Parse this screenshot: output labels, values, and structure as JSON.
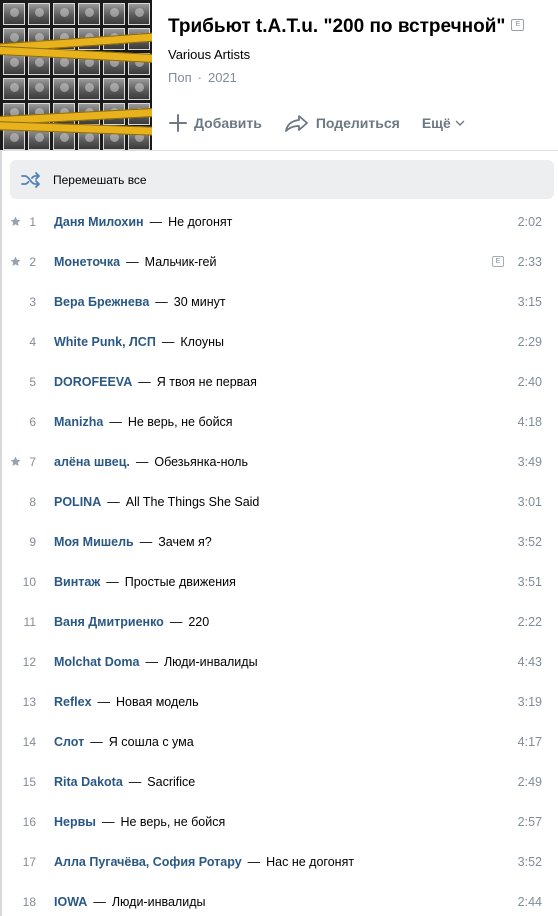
{
  "album": {
    "title": "Трибьют t.A.T.u. \"200 по встречной\"",
    "explicit_badge": "E",
    "artist": "Various Artists",
    "genre": "Поп",
    "separator": "·",
    "year": "2021"
  },
  "actions": {
    "add_label": "Добавить",
    "share_label": "Поделиться",
    "more_label": "Ещё"
  },
  "shuffle": {
    "label": "Перемешать все"
  },
  "colors": {
    "artist_link": "#2a5885",
    "muted": "#818c99",
    "accent_icon": "#5181b8",
    "shuffle_bg": "#edeef0"
  },
  "tracks": [
    {
      "num": "1",
      "starred": true,
      "artists": [
        "Даня Милохин"
      ],
      "title": "Не догонят",
      "duration": "2:02",
      "explicit": false
    },
    {
      "num": "2",
      "starred": true,
      "artists": [
        "Монеточка"
      ],
      "title": "Мальчик-гей",
      "duration": "2:33",
      "explicit": true
    },
    {
      "num": "3",
      "starred": false,
      "artists": [
        "Вера Брежнева"
      ],
      "title": "30 минут",
      "duration": "3:15",
      "explicit": false
    },
    {
      "num": "4",
      "starred": false,
      "artists": [
        "White Punk",
        "ЛСП"
      ],
      "title": "Клоуны",
      "duration": "2:29",
      "explicit": false
    },
    {
      "num": "5",
      "starred": false,
      "artists": [
        "DOROFEEVA"
      ],
      "title": "Я твоя не первая",
      "duration": "2:40",
      "explicit": false
    },
    {
      "num": "6",
      "starred": false,
      "artists": [
        "Manizha"
      ],
      "title": "Не верь, не бойся",
      "duration": "4:18",
      "explicit": false
    },
    {
      "num": "7",
      "starred": true,
      "artists": [
        "алёна швец."
      ],
      "title": "Обезьянка-ноль",
      "duration": "3:49",
      "explicit": false
    },
    {
      "num": "8",
      "starred": false,
      "artists": [
        "POLINA"
      ],
      "title": "All The Things She Said",
      "duration": "3:01",
      "explicit": false
    },
    {
      "num": "9",
      "starred": false,
      "artists": [
        "Моя Мишель"
      ],
      "title": "Зачем я?",
      "duration": "3:52",
      "explicit": false
    },
    {
      "num": "10",
      "starred": false,
      "artists": [
        "Винтаж"
      ],
      "title": "Простые движения",
      "duration": "3:51",
      "explicit": false
    },
    {
      "num": "11",
      "starred": false,
      "artists": [
        "Ваня Дмитриенко"
      ],
      "title": "220",
      "duration": "2:22",
      "explicit": false
    },
    {
      "num": "12",
      "starred": false,
      "artists": [
        "Molchat Doma"
      ],
      "title": "Люди-инвалиды",
      "duration": "4:43",
      "explicit": false
    },
    {
      "num": "13",
      "starred": false,
      "artists": [
        "Reflex"
      ],
      "title": "Новая модель",
      "duration": "3:19",
      "explicit": false
    },
    {
      "num": "14",
      "starred": false,
      "artists": [
        "Слот"
      ],
      "title": "Я сошла с ума",
      "duration": "4:17",
      "explicit": false
    },
    {
      "num": "15",
      "starred": false,
      "artists": [
        "Rita Dakota"
      ],
      "title": "Sacrifice",
      "duration": "2:49",
      "explicit": false
    },
    {
      "num": "16",
      "starred": false,
      "artists": [
        "Нервы"
      ],
      "title": "Не верь, не бойся",
      "duration": "2:57",
      "explicit": false
    },
    {
      "num": "17",
      "starred": false,
      "artists": [
        "Алла Пугачёва",
        "София Ротару"
      ],
      "title": "Нас не догонят",
      "duration": "3:52",
      "explicit": false
    },
    {
      "num": "18",
      "starred": false,
      "artists": [
        "IOWA"
      ],
      "title": "Люди-инвалиды",
      "duration": "2:44",
      "explicit": false
    }
  ]
}
